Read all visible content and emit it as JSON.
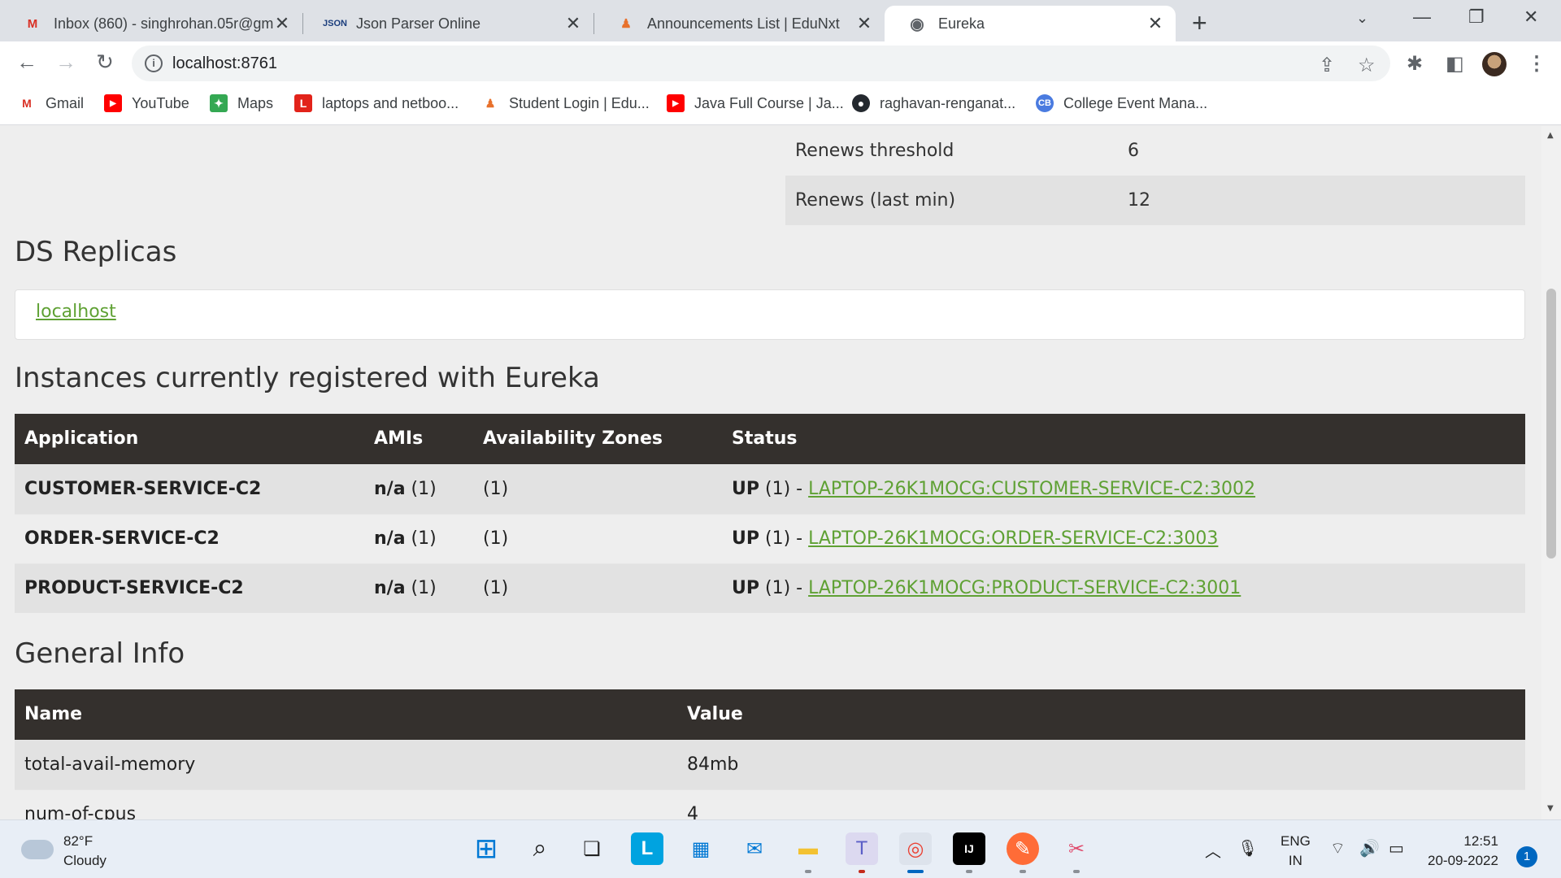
{
  "browser": {
    "tabs": [
      {
        "title": "Inbox (860) - singhrohan.05r@gm",
        "icon": "gmail-icon"
      },
      {
        "title": "Json Parser Online",
        "icon": "json-icon"
      },
      {
        "title": "Announcements List | EduNxt",
        "icon": "edunxt-icon"
      },
      {
        "title": "Eureka",
        "icon": "globe-icon"
      }
    ],
    "url": "localhost:8761",
    "bookmarks": [
      {
        "label": "Gmail"
      },
      {
        "label": "YouTube"
      },
      {
        "label": "Maps"
      },
      {
        "label": "laptops and netboo..."
      },
      {
        "label": "Student Login | Edu..."
      },
      {
        "label": "Java Full Course | Ja..."
      },
      {
        "label": "raghavan-renganat..."
      },
      {
        "label": "College Event Mana..."
      }
    ]
  },
  "renews": [
    {
      "label": "Renews threshold",
      "value": "6"
    },
    {
      "label": "Renews (last min)",
      "value": "12"
    }
  ],
  "replicas": {
    "heading": "DS Replicas",
    "link": "localhost"
  },
  "instances": {
    "heading": "Instances currently registered with Eureka",
    "headers": [
      "Application",
      "AMIs",
      "Availability Zones",
      "Status"
    ],
    "rows": [
      {
        "app": "CUSTOMER-SERVICE-C2",
        "ami_bold": "n/a",
        "ami_count": "(1)",
        "zones": "(1)",
        "status_bold": "UP",
        "status_rest": "(1) -",
        "link": "LAPTOP-26K1MOCG:CUSTOMER-SERVICE-C2:3002"
      },
      {
        "app": "ORDER-SERVICE-C2",
        "ami_bold": "n/a",
        "ami_count": "(1)",
        "zones": "(1)",
        "status_bold": "UP",
        "status_rest": "(1) -",
        "link": "LAPTOP-26K1MOCG:ORDER-SERVICE-C2:3003"
      },
      {
        "app": "PRODUCT-SERVICE-C2",
        "ami_bold": "n/a",
        "ami_count": "(1)",
        "zones": "(1)",
        "status_bold": "UP",
        "status_rest": "(1) -",
        "link": "LAPTOP-26K1MOCG:PRODUCT-SERVICE-C2:3001"
      }
    ]
  },
  "general": {
    "heading": "General Info",
    "headers": [
      "Name",
      "Value"
    ],
    "rows": [
      {
        "name": "total-avail-memory",
        "value": "84mb"
      },
      {
        "name": "num-of-cpus",
        "value": "4"
      }
    ]
  },
  "taskbar": {
    "temperature": "82°F",
    "condition": "Cloudy",
    "lang_top": "ENG",
    "lang_bottom": "IN",
    "time": "12:51",
    "date": "20-09-2022",
    "notifications": "1"
  },
  "colors": {
    "link_green": "#5fa134",
    "table_header": "#34302d",
    "page_bg": "#eeeeee"
  }
}
